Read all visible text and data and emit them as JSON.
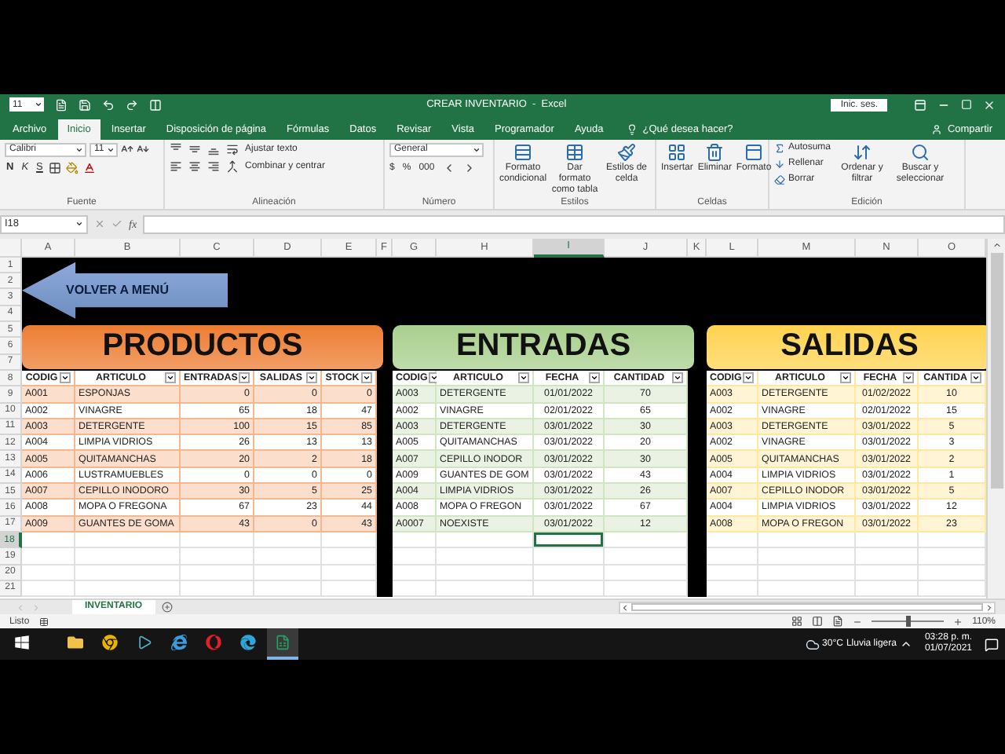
{
  "title_bar": {
    "font_size": "11",
    "title": "CREAR INVENTARIO  -  Excel",
    "sign_in": "Inic. ses."
  },
  "tabs": [
    {
      "label": "Archivo",
      "selected": false
    },
    {
      "label": "Inicio",
      "selected": true
    },
    {
      "label": "Insertar",
      "selected": false
    },
    {
      "label": "Disposición de página",
      "selected": false
    },
    {
      "label": "Fórmulas",
      "selected": false
    },
    {
      "label": "Datos",
      "selected": false
    },
    {
      "label": "Revisar",
      "selected": false
    },
    {
      "label": "Vista",
      "selected": false
    },
    {
      "label": "Programador",
      "selected": false
    },
    {
      "label": "Ayuda",
      "selected": false
    }
  ],
  "tell_me": "¿Qué desea hacer?",
  "share": "Compartir",
  "ribbon": [
    {
      "kind": "font",
      "label": "Fuente",
      "font_name": "Calibri",
      "font_size": "11",
      "bold": "N",
      "italic": "K",
      "underline": "S"
    },
    {
      "kind": "alignment",
      "label": "Alineación",
      "wrap": "Ajustar texto",
      "merge": "Combinar y centrar"
    },
    {
      "kind": "number",
      "label": "Número",
      "format": "General",
      "currency": "$",
      "percent": "%",
      "thousands": "000"
    },
    {
      "kind": "styles",
      "label": "Estilos",
      "buttons": [
        "Formato condicional",
        "Dar formato como tabla",
        "Estilos de celda"
      ]
    },
    {
      "kind": "cells",
      "label": "Celdas",
      "buttons": [
        "Insertar",
        "Eliminar",
        "Formato"
      ]
    },
    {
      "kind": "editing",
      "label": "Edición",
      "small": [
        "Autosuma",
        "Rellenar",
        "Borrar"
      ],
      "large": [
        "Ordenar y filtrar",
        "Buscar y seleccionar"
      ]
    }
  ],
  "formula_bar": {
    "name_box": "I18",
    "fx": "fx"
  },
  "columns": [
    {
      "label": "A",
      "selected": false
    },
    {
      "label": "B",
      "selected": false
    },
    {
      "label": "C",
      "selected": false
    },
    {
      "label": "D",
      "selected": false
    },
    {
      "label": "E",
      "selected": false
    },
    {
      "label": "F",
      "selected": false
    },
    {
      "label": "G",
      "selected": false
    },
    {
      "label": "H",
      "selected": false
    },
    {
      "label": "I",
      "selected": true
    },
    {
      "label": "J",
      "selected": false
    },
    {
      "label": "K",
      "selected": false
    },
    {
      "label": "L",
      "selected": false
    },
    {
      "label": "M",
      "selected": false
    },
    {
      "label": "N",
      "selected": false
    },
    {
      "label": "O",
      "selected": false
    }
  ],
  "rows": [
    {
      "label": "1",
      "selected": false
    },
    {
      "label": "2",
      "selected": false
    },
    {
      "label": "3",
      "selected": false
    },
    {
      "label": "4",
      "selected": false
    },
    {
      "label": "5",
      "selected": false
    },
    {
      "label": "6",
      "selected": false
    },
    {
      "label": "7",
      "selected": false
    },
    {
      "label": "8",
      "selected": false
    },
    {
      "label": "9",
      "selected": false
    },
    {
      "label": "10",
      "selected": false
    },
    {
      "label": "11",
      "selected": false
    },
    {
      "label": "12",
      "selected": false
    },
    {
      "label": "13",
      "selected": false
    },
    {
      "label": "14",
      "selected": false
    },
    {
      "label": "15",
      "selected": false
    },
    {
      "label": "16",
      "selected": false
    },
    {
      "label": "17",
      "selected": false
    },
    {
      "label": "18",
      "selected": true
    },
    {
      "label": "19",
      "selected": false
    },
    {
      "label": "20",
      "selected": false
    },
    {
      "label": "21",
      "selected": false
    }
  ],
  "menu_button": "VOLVER A MENÚ",
  "tables": [
    {
      "title": "PRODUCTOS",
      "color": "#ed7d31",
      "columns": [
        {
          "label": "CODIG",
          "kind": "text"
        },
        {
          "label": "ARTICULO",
          "kind": "text"
        },
        {
          "label": "ENTRADAS",
          "kind": "number"
        },
        {
          "label": "SALIDAS",
          "kind": "number"
        },
        {
          "label": "STOCK",
          "kind": "number"
        }
      ],
      "rows": [
        [
          "A001",
          "ESPONJAS",
          "0",
          "0",
          "0"
        ],
        [
          "A002",
          "VINAGRE",
          "65",
          "18",
          "47"
        ],
        [
          "A003",
          "DETERGENTE",
          "100",
          "15",
          "85"
        ],
        [
          "A004",
          "LIMPIA VIDRIOS",
          "26",
          "13",
          "13"
        ],
        [
          "A005",
          "QUITAMANCHAS",
          "20",
          "2",
          "18"
        ],
        [
          "A006",
          "LUSTRAMUEBLES",
          "0",
          "0",
          "0"
        ],
        [
          "A007",
          "CEPILLO INODORO",
          "30",
          "5",
          "25"
        ],
        [
          "A008",
          "MOPA O FREGONA",
          "67",
          "23",
          "44"
        ],
        [
          "A009",
          "GUANTES DE GOMA",
          "43",
          "0",
          "43"
        ]
      ]
    },
    {
      "title": "ENTRADAS",
      "color": "#a9d08e",
      "columns": [
        {
          "label": "CODIG",
          "kind": "text"
        },
        {
          "label": "ARTICULO",
          "kind": "text"
        },
        {
          "label": "FECHA",
          "kind": "center"
        },
        {
          "label": "CANTIDAD",
          "kind": "center"
        }
      ],
      "rows": [
        [
          "A003",
          "DETERGENTE",
          "01/01/2022",
          "70"
        ],
        [
          "A002",
          "VINAGRE",
          "02/01/2022",
          "65"
        ],
        [
          "A003",
          "DETERGENTE",
          "03/01/2022",
          "30"
        ],
        [
          "A005",
          "QUITAMANCHAS",
          "03/01/2022",
          "20"
        ],
        [
          "A007",
          "CEPILLO INODOR",
          "03/01/2022",
          "30"
        ],
        [
          "A009",
          "GUANTES DE GOM",
          "03/01/2022",
          "43"
        ],
        [
          "A004",
          "LIMPIA VIDRIOS",
          "03/01/2022",
          "26"
        ],
        [
          "A008",
          "MOPA O FREGON",
          "03/01/2022",
          "67"
        ],
        [
          "A0007",
          "NOEXISTE",
          "03/01/2022",
          "12"
        ]
      ]
    },
    {
      "title": "SALIDAS",
      "color": "#ffd34f",
      "columns": [
        {
          "label": "CODIG",
          "kind": "text"
        },
        {
          "label": "ARTICULO",
          "kind": "text"
        },
        {
          "label": "FECHA",
          "kind": "center"
        },
        {
          "label": "CANTIDA",
          "kind": "center"
        }
      ],
      "rows": [
        [
          "A003",
          "DETERGENTE",
          "01/02/2022",
          "10"
        ],
        [
          "A002",
          "VINAGRE",
          "02/01/2022",
          "15"
        ],
        [
          "A003",
          "DETERGENTE",
          "03/01/2022",
          "5"
        ],
        [
          "A002",
          "VINAGRE",
          "03/01/2022",
          "3"
        ],
        [
          "A005",
          "QUITAMANCHAS",
          "03/01/2022",
          "2"
        ],
        [
          "A004",
          "LIMPIA VIDRIOS",
          "03/01/2022",
          "1"
        ],
        [
          "A007",
          "CEPILLO INODOR",
          "03/01/2022",
          "5"
        ],
        [
          "A004",
          "LIMPIA VIDRIOS",
          "03/01/2022",
          "12"
        ],
        [
          "A008",
          "MOPA O FREGON",
          "03/01/2022",
          "23"
        ]
      ]
    }
  ],
  "sheet_tabs": [
    {
      "label": "INVENTARIO",
      "selected": true
    }
  ],
  "status_bar": {
    "status": "Listo",
    "zoom": {
      "label": "110%",
      "level": 0.5
    }
  },
  "taskbar": {
    "apps": [
      {
        "kind": "folder",
        "selected": false
      },
      {
        "kind": "round-browser",
        "selected": false
      },
      {
        "kind": "media",
        "selected": false
      },
      {
        "kind": "e-browser",
        "selected": false
      },
      {
        "kind": "o-browser",
        "selected": false
      },
      {
        "kind": "wave-browser",
        "selected": false
      },
      {
        "kind": "spreadsheet",
        "selected": true
      }
    ],
    "temperature": "30°C",
    "weather": "Lluvia ligera",
    "time": "03:28 p. m.",
    "date": "01/07/2021"
  }
}
